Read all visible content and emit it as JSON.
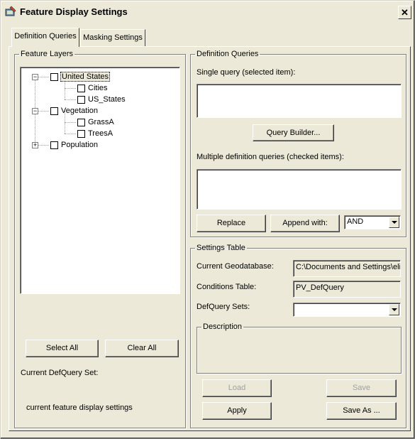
{
  "window": {
    "title": "Feature Display Settings",
    "close_label": "✕"
  },
  "tabs": [
    {
      "label": "Definition Queries",
      "active": true
    },
    {
      "label": "Masking Settings",
      "active": false
    }
  ],
  "feature_layers": {
    "legend": "Feature Layers",
    "tree": [
      {
        "label": "United States",
        "expander": "−",
        "children": [
          "Cities",
          "US_States"
        ]
      },
      {
        "label": "Vegetation",
        "expander": "−",
        "children": [
          "GrassA",
          "TreesA"
        ]
      },
      {
        "label": "Population",
        "expander": "+",
        "children": []
      }
    ],
    "select_all_label": "Select All",
    "clear_all_label": "Clear All",
    "current_defquery_set_label": "Current DefQuery Set:",
    "current_defquery_set_value": "current feature display settings"
  },
  "definition_queries": {
    "legend": "Definition Queries",
    "single_query_label": "Single query (selected item):",
    "single_query_value": "",
    "query_builder_label": "Query Builder...",
    "multiple_label": "Multiple definition queries (checked items):",
    "multiple_value": "",
    "replace_label": "Replace",
    "append_with_label": "Append with:",
    "operator_value": "AND"
  },
  "settings_table": {
    "legend": "Settings Table",
    "current_geodatabase_label": "Current Geodatabase:",
    "current_geodatabase_value": "C:\\Documents and Settings\\eli",
    "conditions_table_label": "Conditions Table:",
    "conditions_table_value": "PV_DefQuery",
    "defquery_sets_label": "DefQuery Sets:",
    "defquery_sets_value": "",
    "description_legend": "Description",
    "load_label": "Load",
    "save_label": "Save",
    "apply_label": "Apply",
    "save_as_label": "Save As ..."
  }
}
